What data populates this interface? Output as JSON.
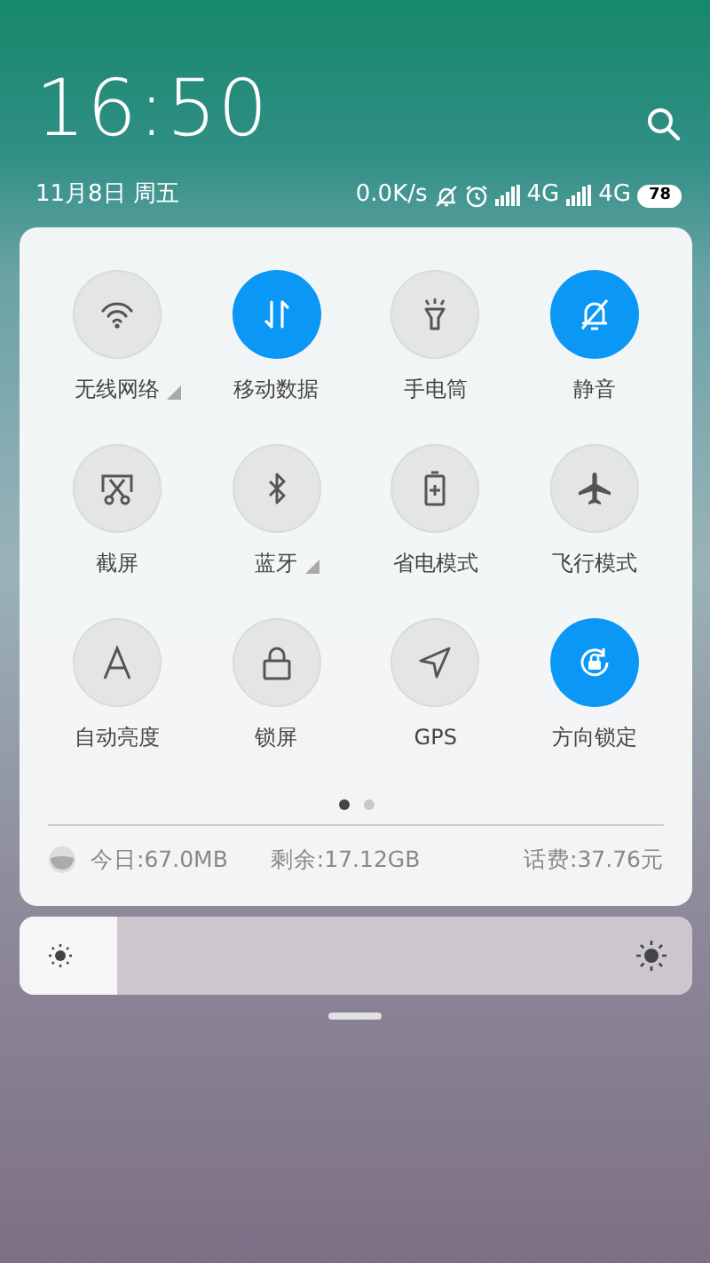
{
  "status": {
    "time": "16:50",
    "date": "11月8日 周五",
    "speed": "0.0K/s",
    "network_1": "4G",
    "network_2": "4G",
    "battery": "78"
  },
  "toggles": [
    {
      "label": "无线网络",
      "on": false,
      "has_menu": true
    },
    {
      "label": "移动数据",
      "on": true,
      "has_menu": false
    },
    {
      "label": "手电筒",
      "on": false,
      "has_menu": false
    },
    {
      "label": "静音",
      "on": true,
      "has_menu": false
    },
    {
      "label": "截屏",
      "on": false,
      "has_menu": false
    },
    {
      "label": "蓝牙",
      "on": false,
      "has_menu": true
    },
    {
      "label": "省电模式",
      "on": false,
      "has_menu": false
    },
    {
      "label": "飞行模式",
      "on": false,
      "has_menu": false
    },
    {
      "label": "自动亮度",
      "on": false,
      "has_menu": false
    },
    {
      "label": "锁屏",
      "on": false,
      "has_menu": false
    },
    {
      "label": "GPS",
      "on": false,
      "has_menu": false
    },
    {
      "label": "方向锁定",
      "on": true,
      "has_menu": false
    }
  ],
  "pages": [
    {
      "selected": true
    },
    {
      "selected": false
    }
  ],
  "usage": {
    "today": "今日:67.0MB",
    "remaining": "剩余:17.12GB",
    "balance": "话费:37.76元"
  },
  "brightness": {
    "level": 0.145
  }
}
